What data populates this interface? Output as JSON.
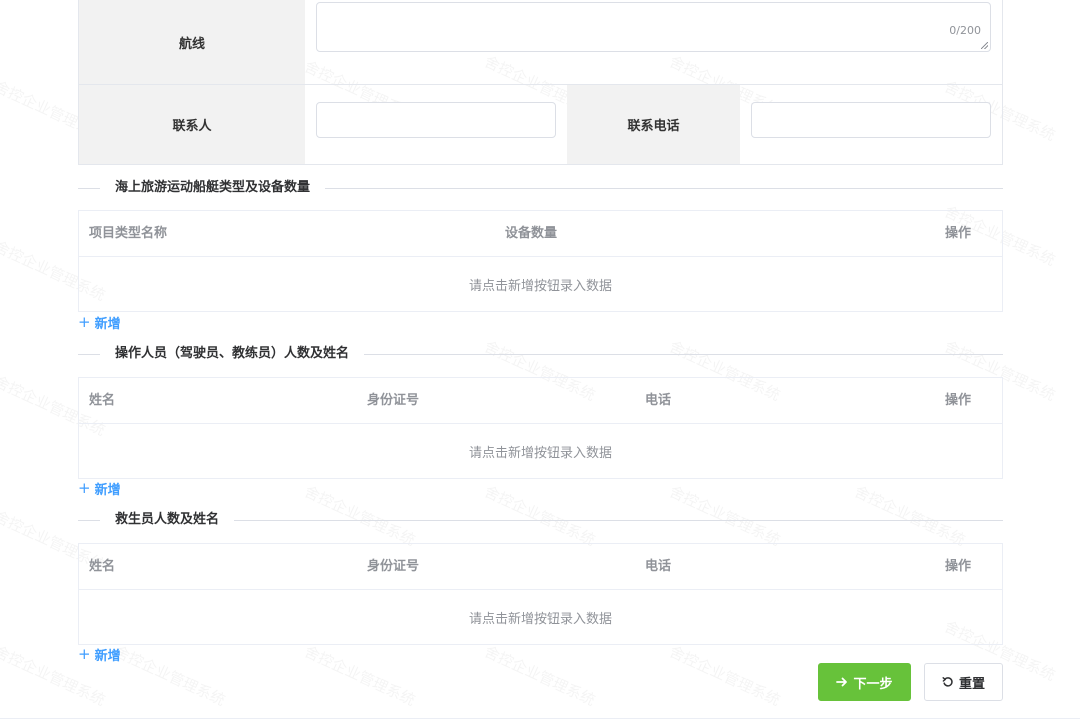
{
  "route_row": {
    "label": "航线",
    "value": "",
    "counter": "0/200"
  },
  "contact_row": {
    "contact_label": "联系人",
    "contact_value": "",
    "phone_label": "联系电话",
    "phone_value": ""
  },
  "vessels": {
    "title": "海上旅游运动船艇类型及设备数量",
    "columns": [
      "项目类型名称",
      "设备数量",
      "操作"
    ],
    "empty_text": "请点击新增按钮录入数据",
    "add_label": "新增"
  },
  "operators": {
    "title": "操作人员（驾驶员、教练员）人数及姓名",
    "columns": [
      "姓名",
      "身份证号",
      "电话",
      "操作"
    ],
    "empty_text": "请点击新增按钮录入数据",
    "add_label": "新增"
  },
  "lifeguards": {
    "title": "救生员人数及姓名",
    "columns": [
      "姓名",
      "身份证号",
      "电话",
      "操作"
    ],
    "empty_text": "请点击新增按钮录入数据",
    "add_label": "新增"
  },
  "actions": {
    "next_label": "下一步",
    "reset_label": "重置"
  },
  "watermark": {
    "text": "舍控企业管理系统"
  },
  "colors": {
    "primary": "#409eff",
    "success": "#67c23a",
    "label_bg": "#f2f2f2",
    "border": "#e4e7ed"
  },
  "icons": {
    "add": "plus-icon",
    "next": "arrow-right-icon",
    "reset": "refresh-icon"
  }
}
